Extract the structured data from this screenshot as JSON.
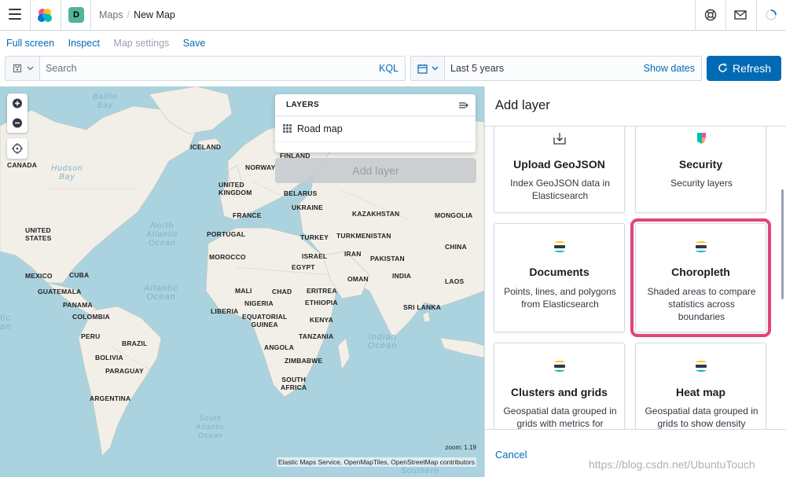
{
  "header": {
    "breadcrumb_parent": "Maps",
    "breadcrumb_current": "New Map",
    "space_initial": "D"
  },
  "topnav": {
    "full_screen": "Full screen",
    "inspect": "Inspect",
    "map_settings": "Map settings",
    "save": "Save"
  },
  "query": {
    "placeholder": "Search",
    "language": "KQL"
  },
  "date": {
    "range": "Last 5 years",
    "show_dates": "Show dates",
    "refresh": "Refresh"
  },
  "map": {
    "countries": [
      {
        "label": "ICELAND"
      },
      {
        "label": "CANADA"
      },
      {
        "label": "NORWAY"
      },
      {
        "label": "FINLAND"
      },
      {
        "label": "UNITED\nKINGDOM"
      },
      {
        "label": "BELARUS"
      },
      {
        "label": "UKRAINE"
      },
      {
        "label": "FRANCE"
      },
      {
        "label": "KAZAKHSTAN"
      },
      {
        "label": "MONGOLIA"
      },
      {
        "label": "UNITED\nSTATES"
      },
      {
        "label": "PORTUGAL"
      },
      {
        "label": "TURKEY"
      },
      {
        "label": "TURKMENISTAN"
      },
      {
        "label": "IRAN"
      },
      {
        "label": "CHINA"
      },
      {
        "label": "ISRAEL"
      },
      {
        "label": "PAKISTAN"
      },
      {
        "label": "MOROCCO"
      },
      {
        "label": "EGYPT"
      },
      {
        "label": "MEXICO"
      },
      {
        "label": "CUBA"
      },
      {
        "label": "OMAN"
      },
      {
        "label": "INDIA"
      },
      {
        "label": "LAOS"
      },
      {
        "label": "GUATEMALA"
      },
      {
        "label": "MALI"
      },
      {
        "label": "CHAD"
      },
      {
        "label": "ERITREA"
      },
      {
        "label": "PANAMA"
      },
      {
        "label": "NIGERIA"
      },
      {
        "label": "ETHIOPIA"
      },
      {
        "label": "SRI LANKA"
      },
      {
        "label": "LIBERIA"
      },
      {
        "label": "COLOMBIA"
      },
      {
        "label": "EQUATORIAL\nGUINEA"
      },
      {
        "label": "KENYA"
      },
      {
        "label": "PERU"
      },
      {
        "label": "TANZANIA"
      },
      {
        "label": "BRAZIL"
      },
      {
        "label": "ANGOLA"
      },
      {
        "label": "BOLIVIA"
      },
      {
        "label": "ZIMBABWE"
      },
      {
        "label": "PARAGUAY"
      },
      {
        "label": "SOUTH\nAFRICA"
      },
      {
        "label": "ARGENTINA"
      }
    ],
    "seas": [
      {
        "label": "Baffin\nBay"
      },
      {
        "label": "Hudson\nBay"
      },
      {
        "label": "North\nAtlantic\nOcean"
      },
      {
        "label": "Atlantic\nOcean"
      },
      {
        "label": "Indian\nOcean"
      },
      {
        "label": "South\nAtlantic\nOcean"
      },
      {
        "label": "fic\nan"
      },
      {
        "label": "Southern"
      }
    ],
    "zoom_readout": "zoom: 1.19",
    "attribution": "Elastic Maps Service, OpenMapTiles, OpenStreetMap contributors"
  },
  "layers": {
    "title": "LAYERS",
    "items": [
      {
        "name": "Road map"
      }
    ],
    "add_button": "Add layer"
  },
  "flyout": {
    "title": "Add layer",
    "cards": [
      {
        "title": "Upload GeoJSON",
        "desc": "Index GeoJSON data in Elasticsearch",
        "icon": "upload-icon"
      },
      {
        "title": "Security",
        "desc": "Security layers",
        "icon": "security-icon"
      },
      {
        "title": "Documents",
        "desc": "Points, lines, and polygons from Elasticsearch",
        "icon": "elasticsearch-icon"
      },
      {
        "title": "Choropleth",
        "desc": "Shaded areas to compare statistics across boundaries",
        "icon": "elasticsearch-icon"
      },
      {
        "title": "Clusters and grids",
        "desc": "Geospatial data grouped in grids with metrics for",
        "icon": "elasticsearch-icon"
      },
      {
        "title": "Heat map",
        "desc": "Geospatial data grouped in grids to show density",
        "icon": "elasticsearch-icon"
      }
    ],
    "cancel": "Cancel"
  },
  "watermark": "https://blog.csdn.net/UbuntuTouch",
  "colors": {
    "accent": "#006bb4",
    "highlight": "#e0457b",
    "water": "#aad3df",
    "land": "#f2efe9"
  }
}
